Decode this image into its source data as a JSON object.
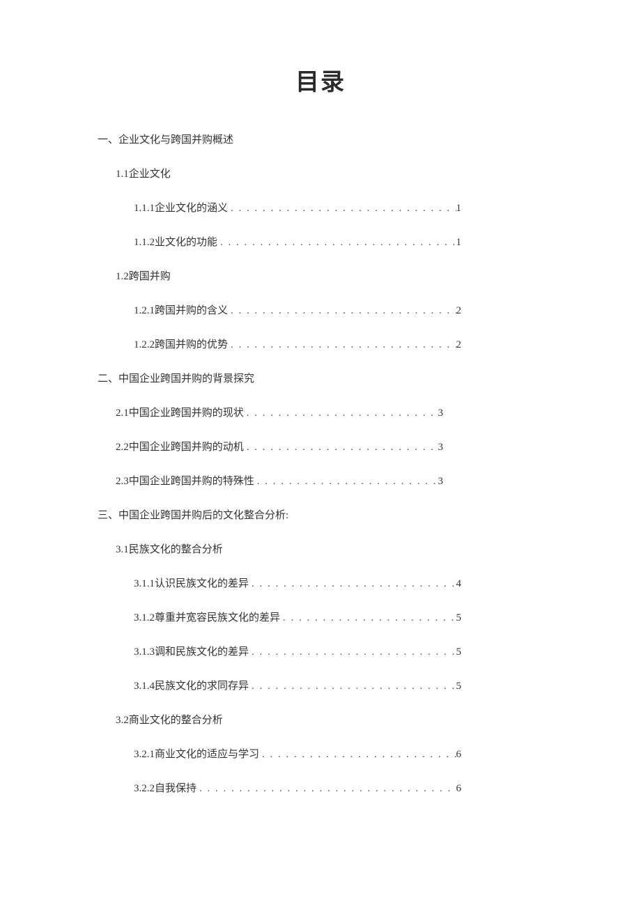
{
  "title": "目录",
  "sections": {
    "s1": {
      "heading": "一、企业文化与跨国并购概述",
      "sub1_1": "1.1企业文化",
      "sub1_1_1": {
        "text": "1.1.1企业文化的涵义",
        "page": "1"
      },
      "sub1_1_2": {
        "text": "1.1.2业文化的功能",
        "page": "1"
      },
      "sub1_2": "1.2跨国并购",
      "sub1_2_1": {
        "text": "1.2.1跨国并购的含义",
        "page": "2"
      },
      "sub1_2_2": {
        "text": "1.2.2跨国并购的优势",
        "page": "2"
      }
    },
    "s2": {
      "heading": "二、中国企业跨国并购的背景探究",
      "sub2_1": {
        "text": "2.1中国企业跨国并购的现状",
        "page": "3"
      },
      "sub2_2": {
        "text": "2.2中国企业跨国并购的动机",
        "page": "3"
      },
      "sub2_3": {
        "text": "2.3中国企业跨国并购的特殊性",
        "page": "3"
      }
    },
    "s3": {
      "heading": "三、中国企业跨国并购后的文化整合分析:",
      "sub3_1": "3.1民族文化的整合分析",
      "sub3_1_1": {
        "text": "3.1.1认识民族文化的差异",
        "page": "4"
      },
      "sub3_1_2": {
        "text": "3.1.2尊重并宽容民族文化的差异",
        "page": "5"
      },
      "sub3_1_3": {
        "text": "3.1.3调和民族文化的差异",
        "page": "5"
      },
      "sub3_1_4": {
        "text": "3.1.4民族文化的求同存异",
        "page": "5"
      },
      "sub3_2": "3.2商业文化的整合分析",
      "sub3_2_1": {
        "text": "3.2.1商业文化的适应与学习",
        "page": "6"
      },
      "sub3_2_2": {
        "text": "3.2.2自我保持",
        "page": "6"
      }
    }
  }
}
